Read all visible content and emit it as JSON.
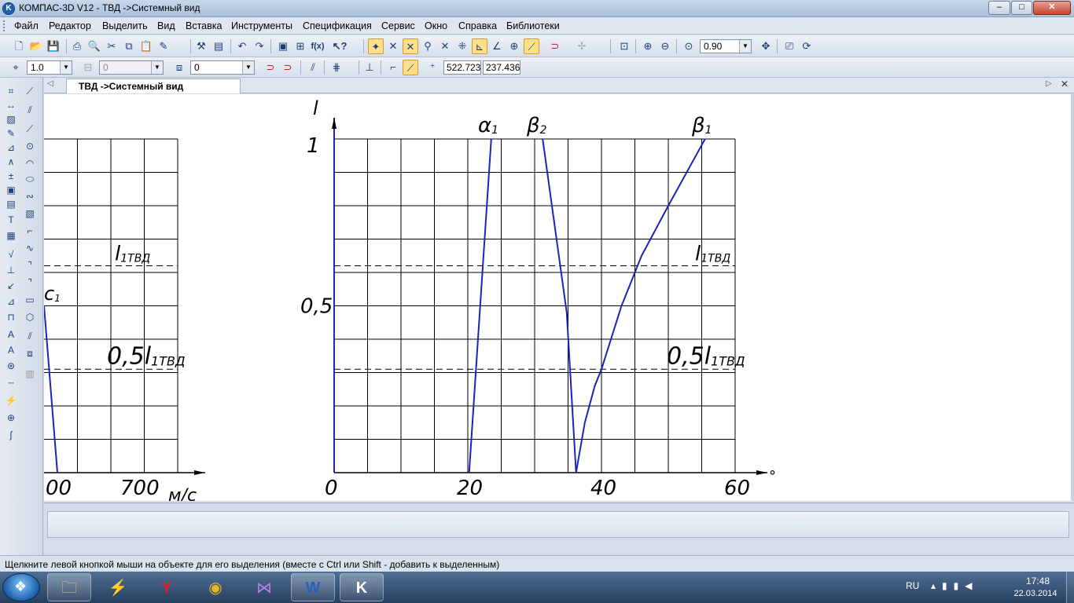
{
  "window": {
    "title": "КОМПАС-3D V12 - ТВД ->Системный вид",
    "logo": "K",
    "controls": {
      "minimize": "–",
      "maximize": "□",
      "close": "✕"
    }
  },
  "menu": [
    "Файл",
    "Редактор",
    "Выделить",
    "Вид",
    "Вставка",
    "Инструменты",
    "Спецификация",
    "Сервис",
    "Окно",
    "Справка",
    "Библиотеки"
  ],
  "toolbar1": {
    "icons": [
      "new-document-icon",
      "open-icon",
      "save-icon",
      "print-icon",
      "preview-icon",
      "cut-icon",
      "copy-icon",
      "paste-icon",
      "format-painter-icon",
      "properties-icon",
      "undo-icon",
      "redo-icon",
      "manager-icon",
      "tree-icon",
      "variables-icon",
      "help-icon",
      "snap-grid-icon",
      "snap-intersection-icon",
      "snap-nearest-icon",
      "snap-center-icon",
      "snap-angle-icon",
      "snap-parallel-icon",
      "snap-perpendicular-icon",
      "snap-point-icon",
      "snap-tangent-icon",
      "magnet-icon",
      "zoom-window-icon",
      "zoom-in-icon",
      "zoom-out-icon",
      "zoom-scale-icon",
      "pan-icon",
      "refresh-icon",
      "redraw-icon"
    ],
    "zoom_value": "0.90"
  },
  "toolbar2": {
    "step_value": "1.0",
    "style_value": "0",
    "layer_value": "0",
    "coord_x": "522.723",
    "coord_y": "237.436"
  },
  "doc_tab": {
    "label": "ТВД ->Системный вид",
    "left_arrow": "◁",
    "right_arrow": "▷",
    "close": "✕"
  },
  "chart_data": [
    {
      "type": "line",
      "title": "",
      "xlabel": "м/с",
      "ylabel": "",
      "x_tick_labels": [
        "00",
        "700"
      ],
      "y_ticks": [],
      "grid": true,
      "series": [
        {
          "name": "c1",
          "points": [
            [
              0,
              0.5
            ],
            [
              0.4,
              0
            ]
          ]
        }
      ],
      "reference_lines": [
        {
          "label_main": "l",
          "label_sub": "1ТВД",
          "value": 0.62
        },
        {
          "label_main": "0,5l",
          "label_sub": "1ТВД",
          "value": 0.31
        }
      ]
    },
    {
      "type": "line",
      "title": "",
      "xlabel": "°",
      "ylabel": "l",
      "x_tick_labels": [
        "0",
        "20",
        "40",
        "60"
      ],
      "x_ticks": [
        0,
        20,
        40,
        60
      ],
      "y_tick_labels": [
        "0,5",
        "1"
      ],
      "y_ticks": [
        0.5,
        1
      ],
      "xlim": [
        0,
        60
      ],
      "ylim": [
        0,
        1
      ],
      "grid": true,
      "series": [
        {
          "name": "α",
          "sub": "1",
          "points": [
            [
              20.2,
              0
            ],
            [
              23.5,
              1
            ]
          ]
        },
        {
          "name": "β",
          "sub": "2",
          "points": [
            [
              31.2,
              1
            ],
            [
              34.8,
              0.48
            ],
            [
              36.2,
              0
            ]
          ]
        },
        {
          "name": "β",
          "sub": "1",
          "points": [
            [
              36.2,
              0
            ],
            [
              37.5,
              0.15
            ],
            [
              39,
              0.26
            ],
            [
              40,
              0.31
            ],
            [
              43,
              0.5
            ],
            [
              46,
              0.65
            ],
            [
              50,
              0.8
            ],
            [
              55.5,
              1
            ]
          ]
        }
      ],
      "reference_lines": [
        {
          "label_main": "l",
          "label_sub": "1ТВД",
          "value": 0.62
        },
        {
          "label_main": "0,5l",
          "label_sub": "1ТВД",
          "value": 0.31
        }
      ]
    }
  ],
  "status": {
    "hint": "Щелкните левой кнопкой мыши на объекте для его выделения (вместе с Ctrl или Shift - добавить к выделенным)"
  },
  "taskbar": {
    "apps": [
      "explorer-icon",
      "winrar-icon",
      "yandex-browser-icon",
      "chrome-icon",
      "visual-studio-icon",
      "word-icon",
      "kompas-icon"
    ],
    "lang": "RU",
    "time": "17:48",
    "date": "22.03.2014"
  },
  "colors": {
    "curve": "#1a24b8",
    "grid": "#000000",
    "accent": "#ffe08a"
  }
}
